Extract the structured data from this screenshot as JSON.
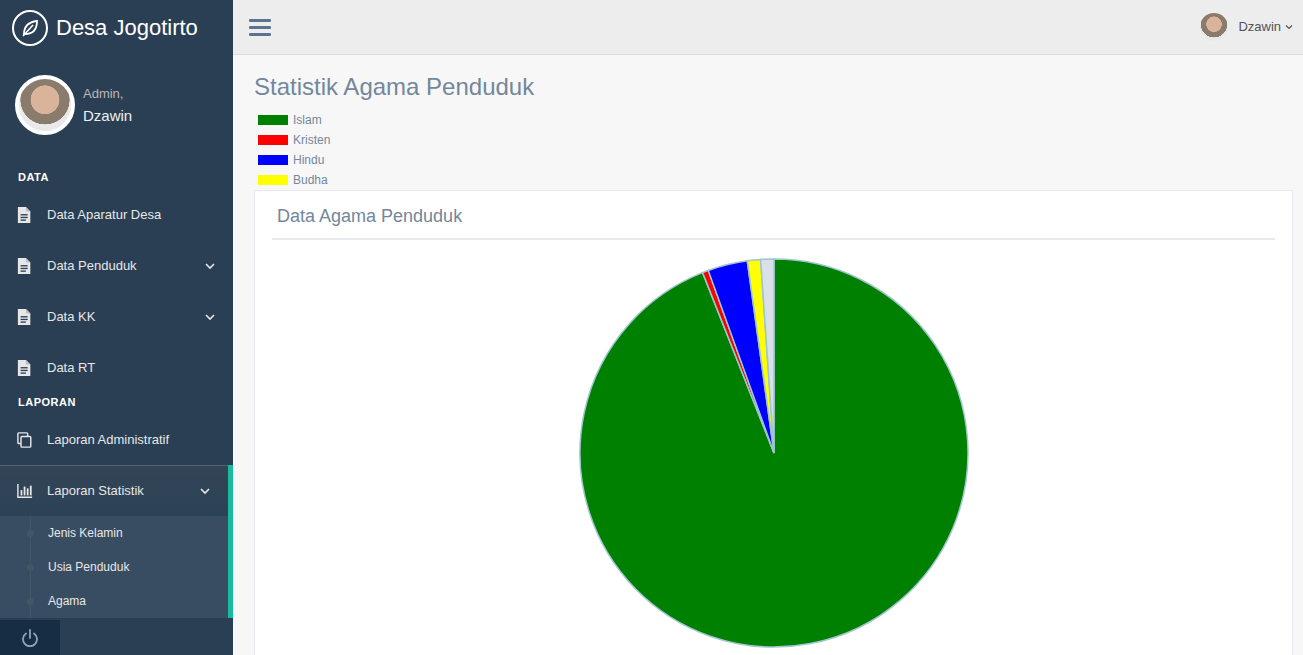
{
  "sidebar": {
    "brand": "Desa Jogotirto",
    "profile": {
      "greeting": "Admin,",
      "name": "Dzawin"
    },
    "sections": [
      {
        "heading": "DATA",
        "items": [
          {
            "label": "Data Aparatur Desa",
            "kind": "link",
            "selected": false
          },
          {
            "label": "Data Penduduk",
            "kind": "dropdown",
            "expanded": false,
            "selected": false
          },
          {
            "label": "Data KK",
            "kind": "dropdown",
            "expanded": false,
            "selected": false
          },
          {
            "label": "Data RT",
            "kind": "link",
            "selected": false
          }
        ]
      },
      {
        "heading": "LAPORAN",
        "items": [
          {
            "label": "Laporan Administratif",
            "kind": "link",
            "selected": false
          },
          {
            "label": "Laporan Statistik",
            "kind": "dropdown",
            "expanded": true,
            "selected": true,
            "children": [
              {
                "label": "Jenis Kelamin",
                "selected": false
              },
              {
                "label": "Usia Penduduk",
                "selected": false
              },
              {
                "label": "Agama",
                "selected": false
              }
            ]
          }
        ]
      }
    ]
  },
  "top_nav": {
    "user": {
      "name": "Dzawin"
    }
  },
  "page": {
    "title": "Statistik Agama Penduduk",
    "legend": [
      {
        "label": "Islam",
        "color": "#008000"
      },
      {
        "label": "Kristen",
        "color": "#ff0000"
      },
      {
        "label": "Hindu",
        "color": "#0000ff"
      },
      {
        "label": "Budha",
        "color": "#ffff00"
      }
    ],
    "panel": {
      "title": "Data Agama Penduduk",
      "chart": {
        "slices": [
          {
            "value": 940,
            "color": "#008000"
          },
          {
            "value": 5,
            "color": "#ff0000"
          },
          {
            "value": 33,
            "color": "#0000ff"
          },
          {
            "value": 11,
            "color": "#ffff00"
          },
          {
            "value": 11,
            "color": "#d9e1e8"
          }
        ]
      }
    }
  }
}
